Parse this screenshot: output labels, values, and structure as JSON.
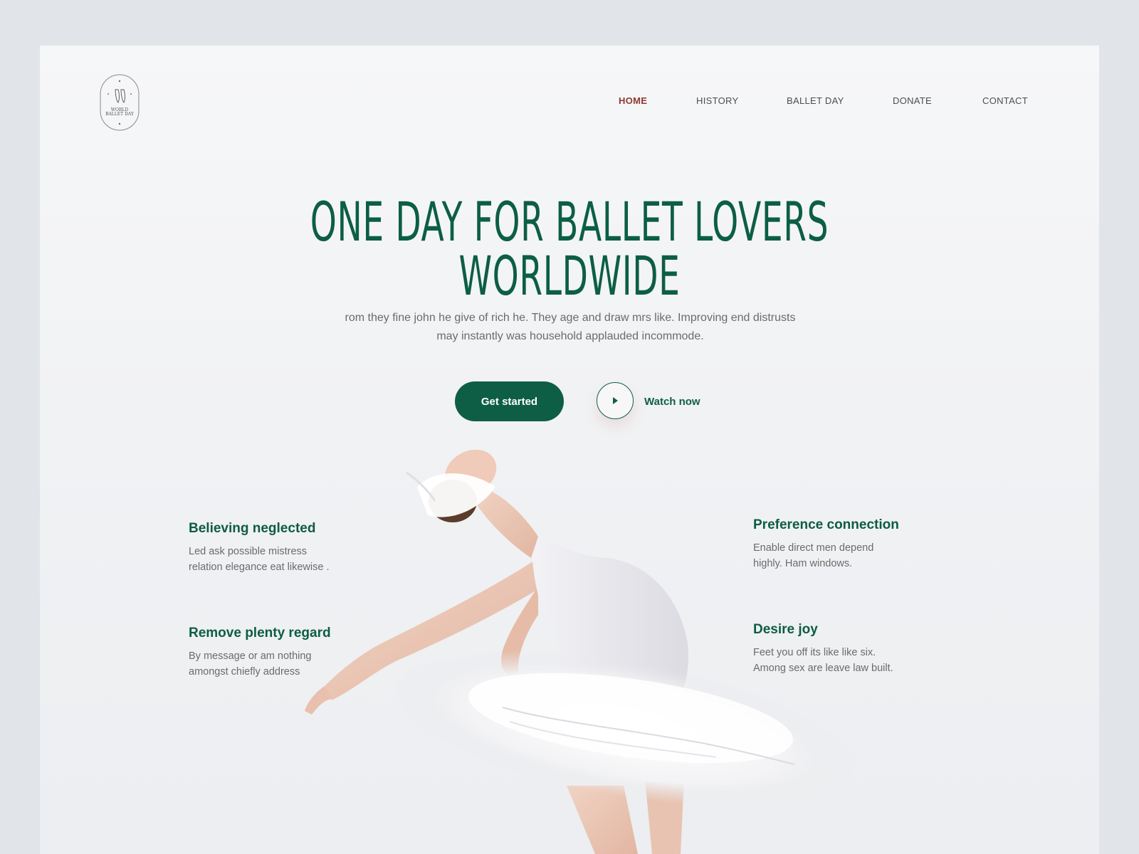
{
  "brand": {
    "logo_line1": "WORLD",
    "logo_line2": "BALLET DAY"
  },
  "nav": {
    "items": [
      {
        "label": "HOME",
        "active": true
      },
      {
        "label": "HISTORY",
        "active": false
      },
      {
        "label": "BALLET DAY",
        "active": false
      },
      {
        "label": "DONATE",
        "active": false
      },
      {
        "label": "CONTACT",
        "active": false
      }
    ]
  },
  "hero": {
    "title": "ONE DAY FOR BALLET LOVERS WORLDWIDE",
    "subtitle_line1": "rom they fine john he give of rich he. They age and draw mrs like. Improving end distrusts",
    "subtitle_line2": "may instantly was household applauded incommode.",
    "primary_button": "Get started",
    "watch_label": "Watch now"
  },
  "features": [
    {
      "title": "Believing neglected",
      "line1": "Led ask possible mistress",
      "line2": "relation elegance eat likewise ."
    },
    {
      "title": "Remove plenty regard",
      "line1": "By message or am nothing",
      "line2": "amongst chiefly address"
    },
    {
      "title": "Preference connection",
      "line1": "Enable direct men depend",
      "line2": "highly. Ham windows."
    },
    {
      "title": "Desire joy",
      "line1": "Feet you off its like like six.",
      "line2": "Among sex are leave law built."
    }
  ],
  "colors": {
    "accent": "#0e5e46",
    "active_nav": "#8b3a2f",
    "text_muted": "#6b6b6b",
    "page_bg": "#e1e4e8"
  }
}
